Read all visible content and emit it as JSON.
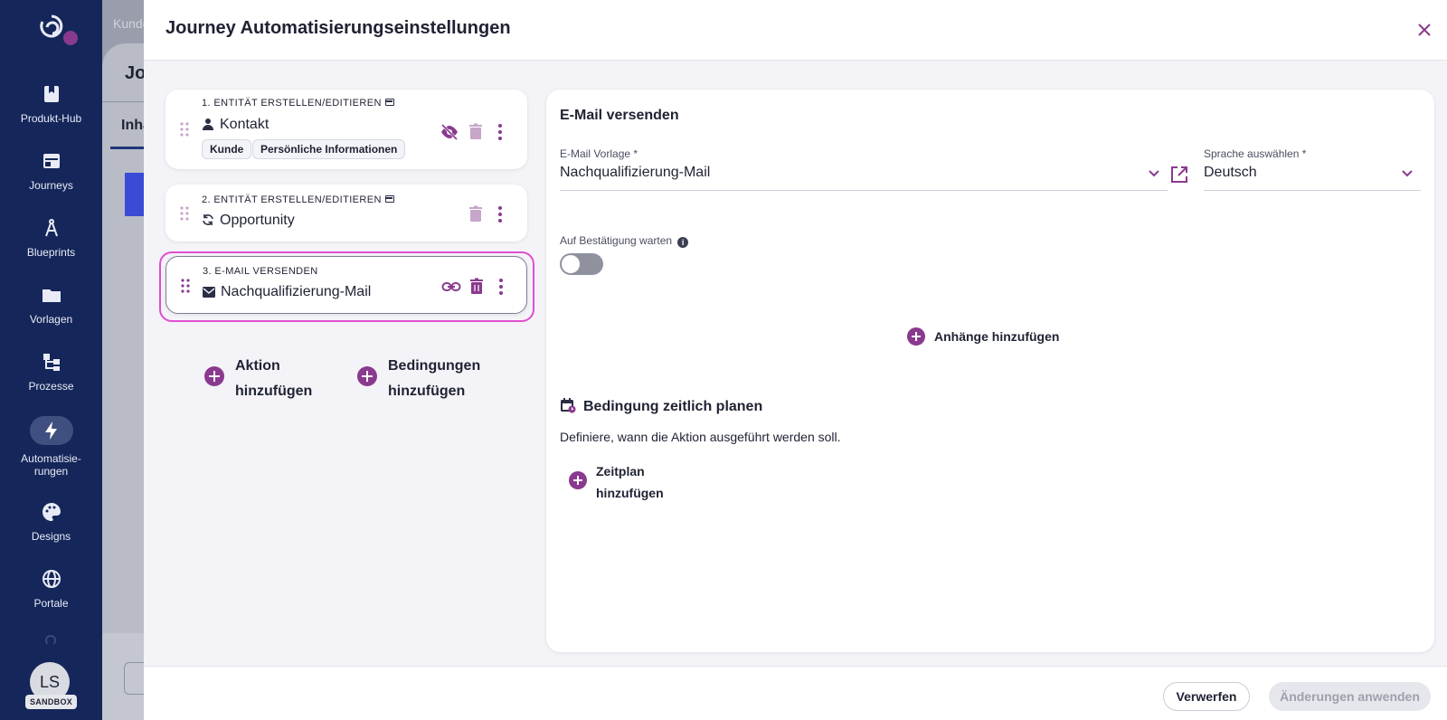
{
  "nav": {
    "items": [
      {
        "label": "Produkt-Hub",
        "icon": "book-icon"
      },
      {
        "label": "Journeys",
        "icon": "journeys-icon"
      },
      {
        "label": "Blueprints",
        "icon": "compass-icon"
      },
      {
        "label": "Vorlagen",
        "icon": "folder-icon"
      },
      {
        "label": "Prozesse",
        "icon": "process-icon"
      },
      {
        "label": "Automatisie-rungen",
        "icon": "bolt-icon"
      },
      {
        "label": "Designs",
        "icon": "palette-icon"
      },
      {
        "label": "Portale",
        "icon": "globe-icon"
      }
    ],
    "avatar_initials": "LS",
    "sandbox_badge": "SANDBOX",
    "accent": "#15265a"
  },
  "background": {
    "breadcrumb": "Kunde",
    "title": "Jo",
    "tab": "Inha"
  },
  "modal": {
    "title": "Journey Automatisierungseinstellungen",
    "actions": [
      {
        "label": "1. ENTITÄT ERSTELLEN/EDITIEREN",
        "name": "Kontakt",
        "tags": [
          "Kunde",
          "Persönliche Informationen"
        ]
      },
      {
        "label": "2. ENTITÄT ERSTELLEN/EDITIEREN",
        "name": "Opportunity"
      },
      {
        "label": "3. E-MAIL VERSENDEN",
        "name": "Nachqualifizierung-Mail"
      }
    ],
    "add_action": "Aktion hinzufügen",
    "add_conditions": "Bedingungen hinzufügen",
    "footer": {
      "discard": "Verwerfen",
      "apply": "Änderungen anwenden"
    }
  },
  "panel": {
    "title": "E-Mail versenden",
    "template_label": "E-Mail Vorlage *",
    "template_value": "Nachqualifizierung-Mail",
    "language_label": "Sprache auswählen *",
    "language_value": "Deutsch",
    "wait_label": "Auf Bestätigung warten",
    "wait_enabled": false,
    "add_attachments": "Anhänge hinzufügen",
    "schedule_title": "Bedingung zeitlich planen",
    "schedule_desc": "Definiere, wann die Aktion ausgeführt werden soll.",
    "add_schedule": "Zeitplan hinzufügen"
  },
  "colors": {
    "brand": "#8a3a8e",
    "selected_outline": "#e04ecf"
  }
}
